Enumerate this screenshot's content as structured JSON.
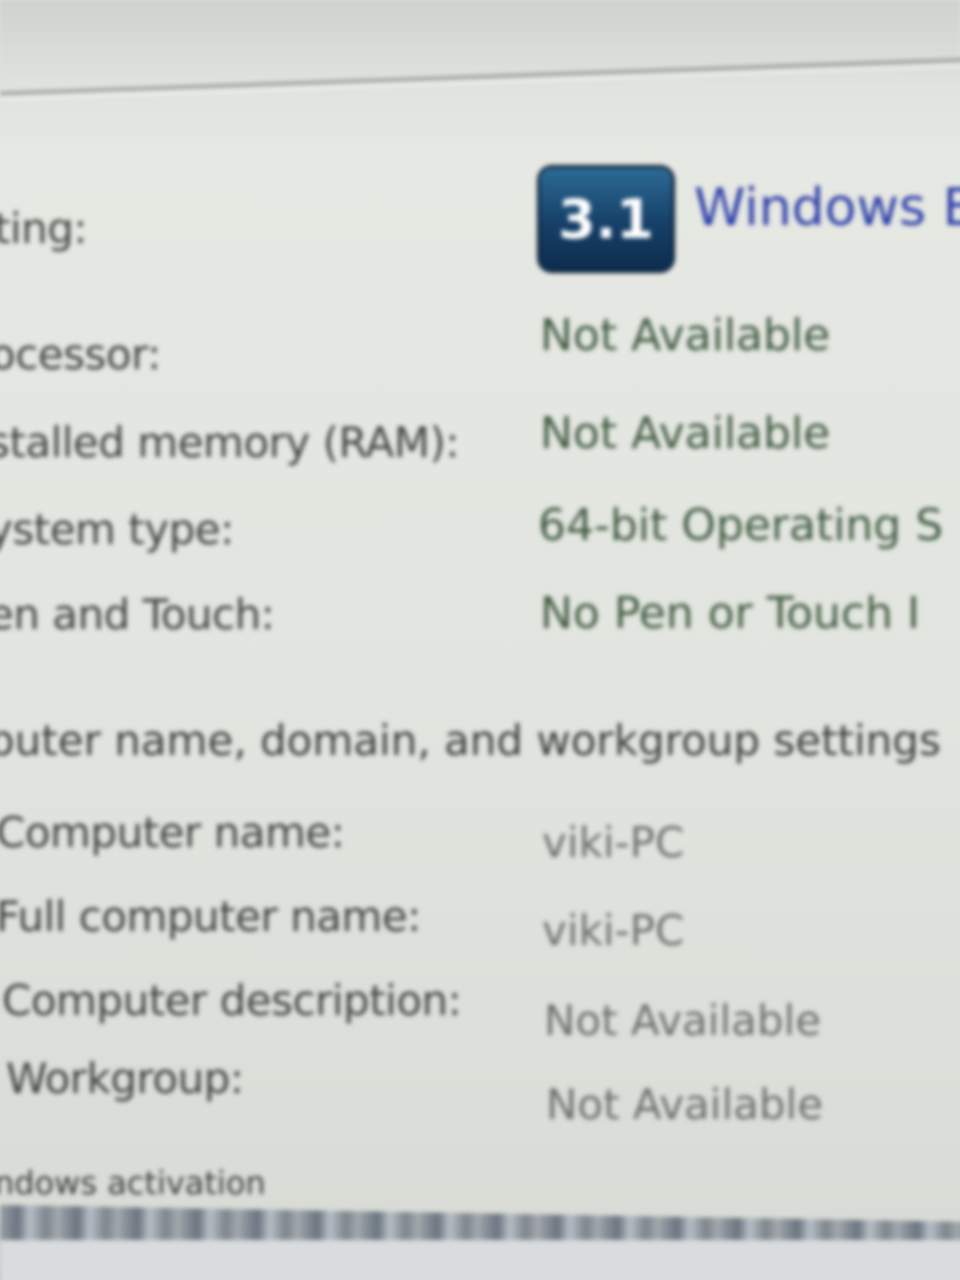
{
  "rating": {
    "label": "ting:",
    "score": "3.1",
    "link_text": "Windows E"
  },
  "system": {
    "rows": [
      {
        "label": "ocessor:",
        "value": "Not Available"
      },
      {
        "label": "stalled memory (RAM):",
        "value": "Not Available"
      },
      {
        "label": "ystem type:",
        "value": "64-bit Operating S"
      },
      {
        "label": "en and Touch:",
        "value": "No Pen or Touch I"
      }
    ]
  },
  "computer": {
    "section_title": "puter name, domain, and workgroup settings",
    "rows": [
      {
        "label": "Computer name:",
        "value": "viki-PC"
      },
      {
        "label": "Full computer name:",
        "value": "viki-PC"
      },
      {
        "label": "Computer description:",
        "value": "Not Available"
      },
      {
        "label": "Workgroup:",
        "value": "Not Available"
      }
    ]
  },
  "activation": {
    "section_title": "ndows activation"
  },
  "colors": {
    "badge": "#153f67",
    "link": "#2d3fa8",
    "value_text": "#3f5a40"
  },
  "icons": {
    "rating_badge": "windows-experience-index-icon"
  }
}
